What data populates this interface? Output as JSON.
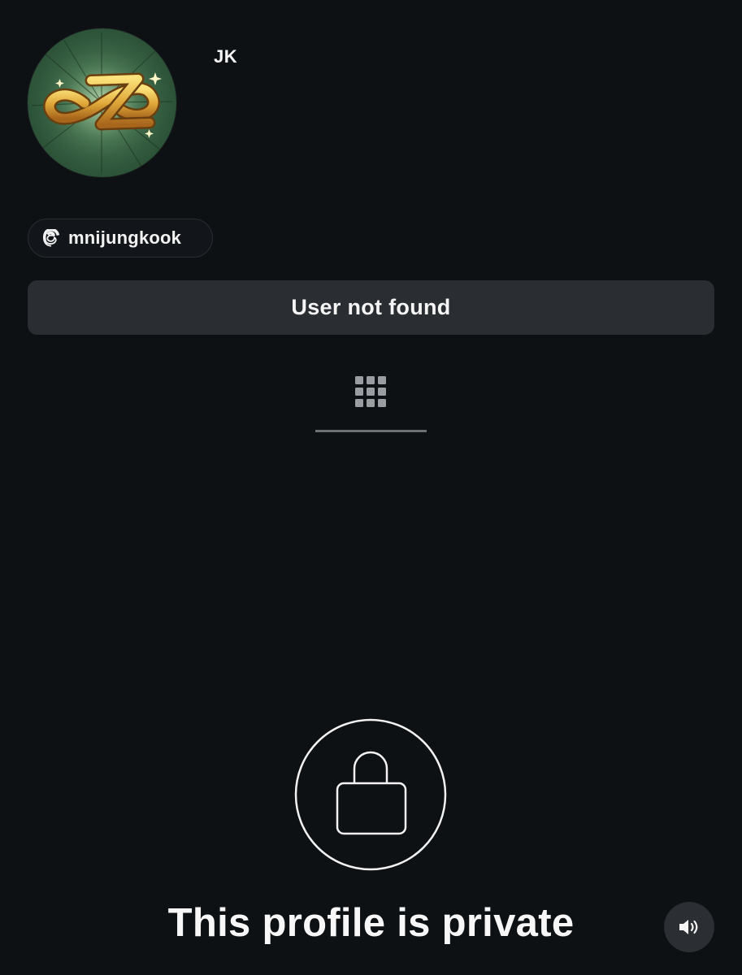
{
  "profile": {
    "display_name": "JK",
    "avatar_icon": "gold-ampersand-logo-icon"
  },
  "threads_badge": {
    "icon": "threads-at-icon",
    "handle": "mnijungkook"
  },
  "status_button": {
    "label": "User not found"
  },
  "tabs": {
    "active": "grid",
    "grid_icon": "grid-icon"
  },
  "private_notice": {
    "icon": "lock-icon",
    "message": "This profile is private"
  },
  "media_controls": {
    "sound_icon": "speaker-icon"
  },
  "colors": {
    "background": "#0e1114",
    "button": "#2a2d31",
    "text": "#f5f5f5"
  }
}
